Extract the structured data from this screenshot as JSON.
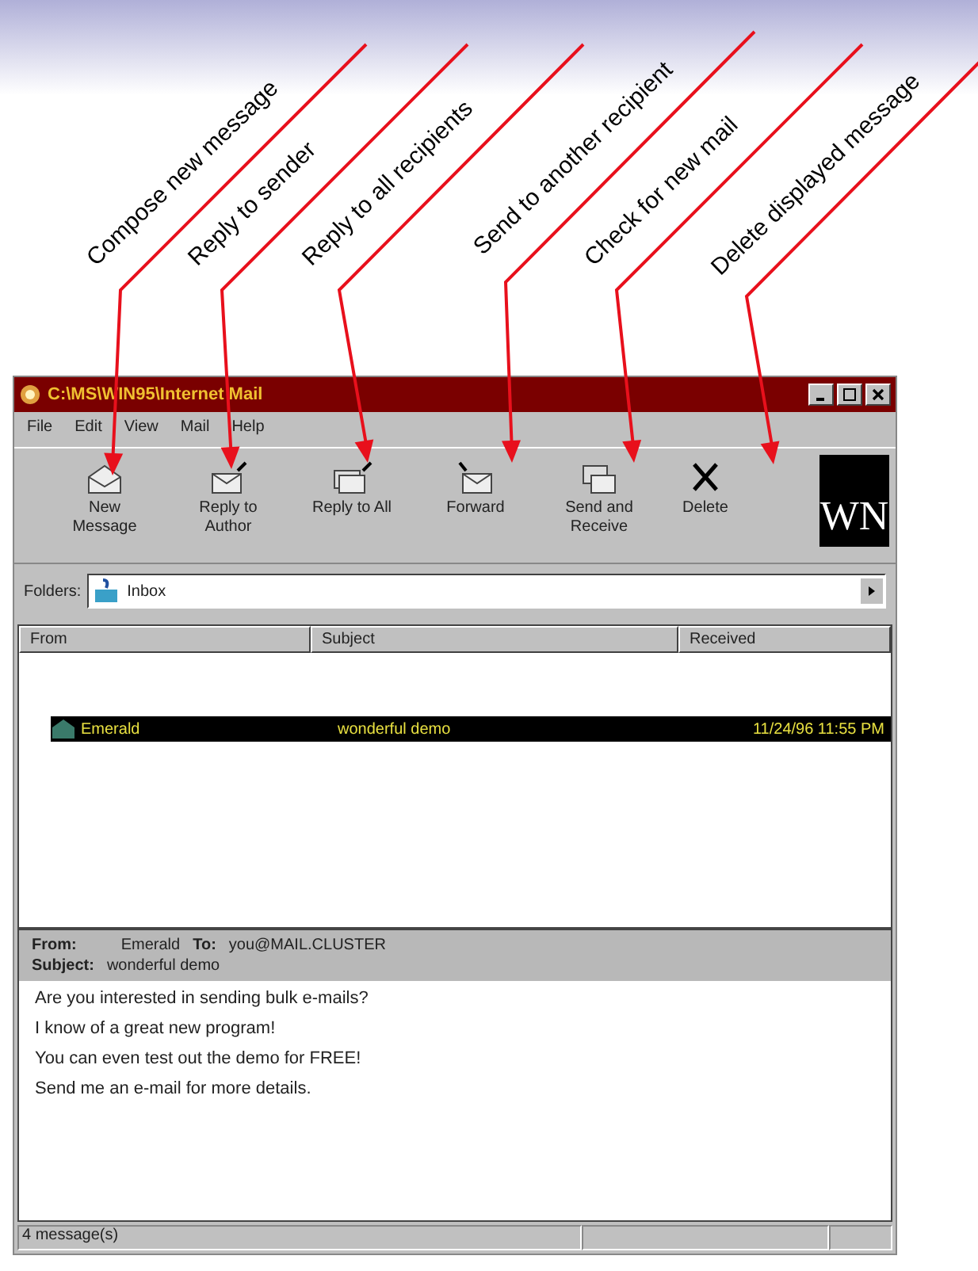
{
  "annotations": [
    {
      "label": "Compose new message"
    },
    {
      "label": "Reply to sender"
    },
    {
      "label": "Reply to all recipients"
    },
    {
      "label": "Send to another recipient"
    },
    {
      "label": "Check for new mail"
    },
    {
      "label": "Delete displayed message"
    }
  ],
  "window": {
    "title": "C:\\MS\\WIN95\\Internet Mail"
  },
  "menu": [
    "File",
    "Edit",
    "View",
    "Mail",
    "Help"
  ],
  "toolbar": [
    {
      "label": "New Message",
      "kind": "new"
    },
    {
      "label": "Reply to Author",
      "kind": "reply"
    },
    {
      "label": "Reply to All",
      "kind": "replyall"
    },
    {
      "label": "Forward",
      "kind": "forward"
    },
    {
      "label": "Send and Receive",
      "kind": "sendrecv"
    },
    {
      "label": "Delete",
      "kind": "delete"
    }
  ],
  "logo": "WN",
  "folder": {
    "label": "Folders:",
    "value": "Inbox"
  },
  "columns": [
    "From",
    "Subject",
    "Received"
  ],
  "messages": [
    {
      "from": "Emerald",
      "subject": "wonderful demo",
      "received": "11/24/96 11:55 PM",
      "selected": true
    }
  ],
  "preview": {
    "from_label": "From:",
    "from": "Emerald",
    "to_label": "To:",
    "to": "you@MAIL.CLUSTER",
    "subject_label": "Subject:",
    "subject": "wonderful demo",
    "body": [
      "Are you interested in sending bulk e-mails?",
      "I know of a great new program!",
      "You can even test out the demo for FREE!",
      "Send me an e-mail for more details."
    ]
  },
  "status_bar": "4 message(s)"
}
